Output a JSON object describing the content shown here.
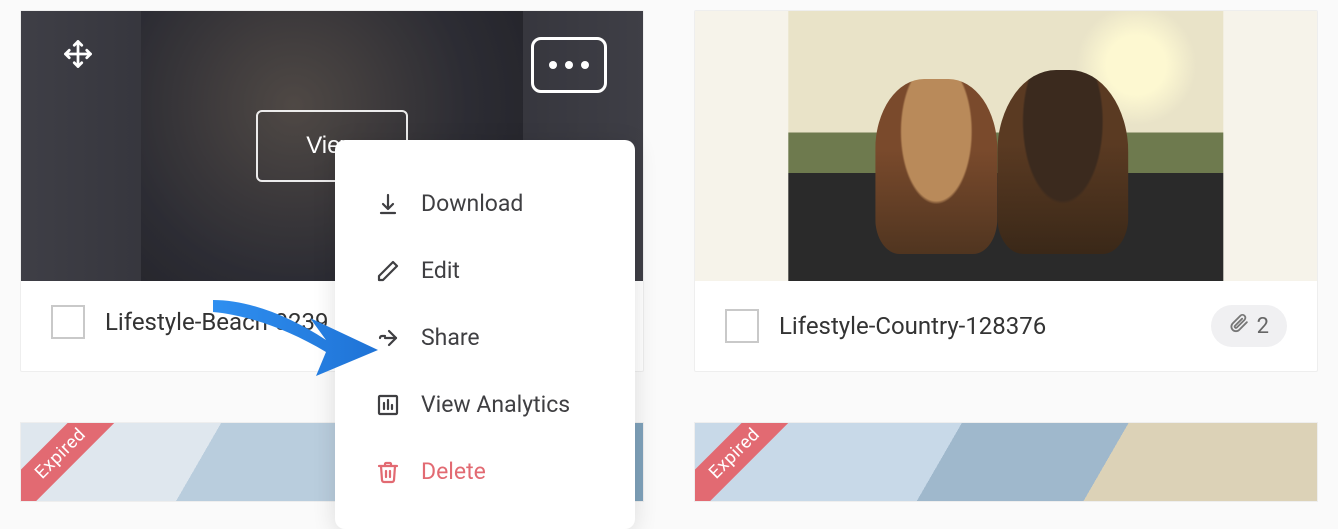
{
  "cards": [
    {
      "filename": "Lifestyle-Beach-0239",
      "view_label": "View",
      "hovered": true
    },
    {
      "filename": "Lifestyle-Country-128376",
      "attachment_count": "2"
    }
  ],
  "row2": {
    "ribbon_label": "Expired"
  },
  "menu": {
    "download": "Download",
    "edit": "Edit",
    "share": "Share",
    "analytics": "View Analytics",
    "delete": "Delete"
  }
}
